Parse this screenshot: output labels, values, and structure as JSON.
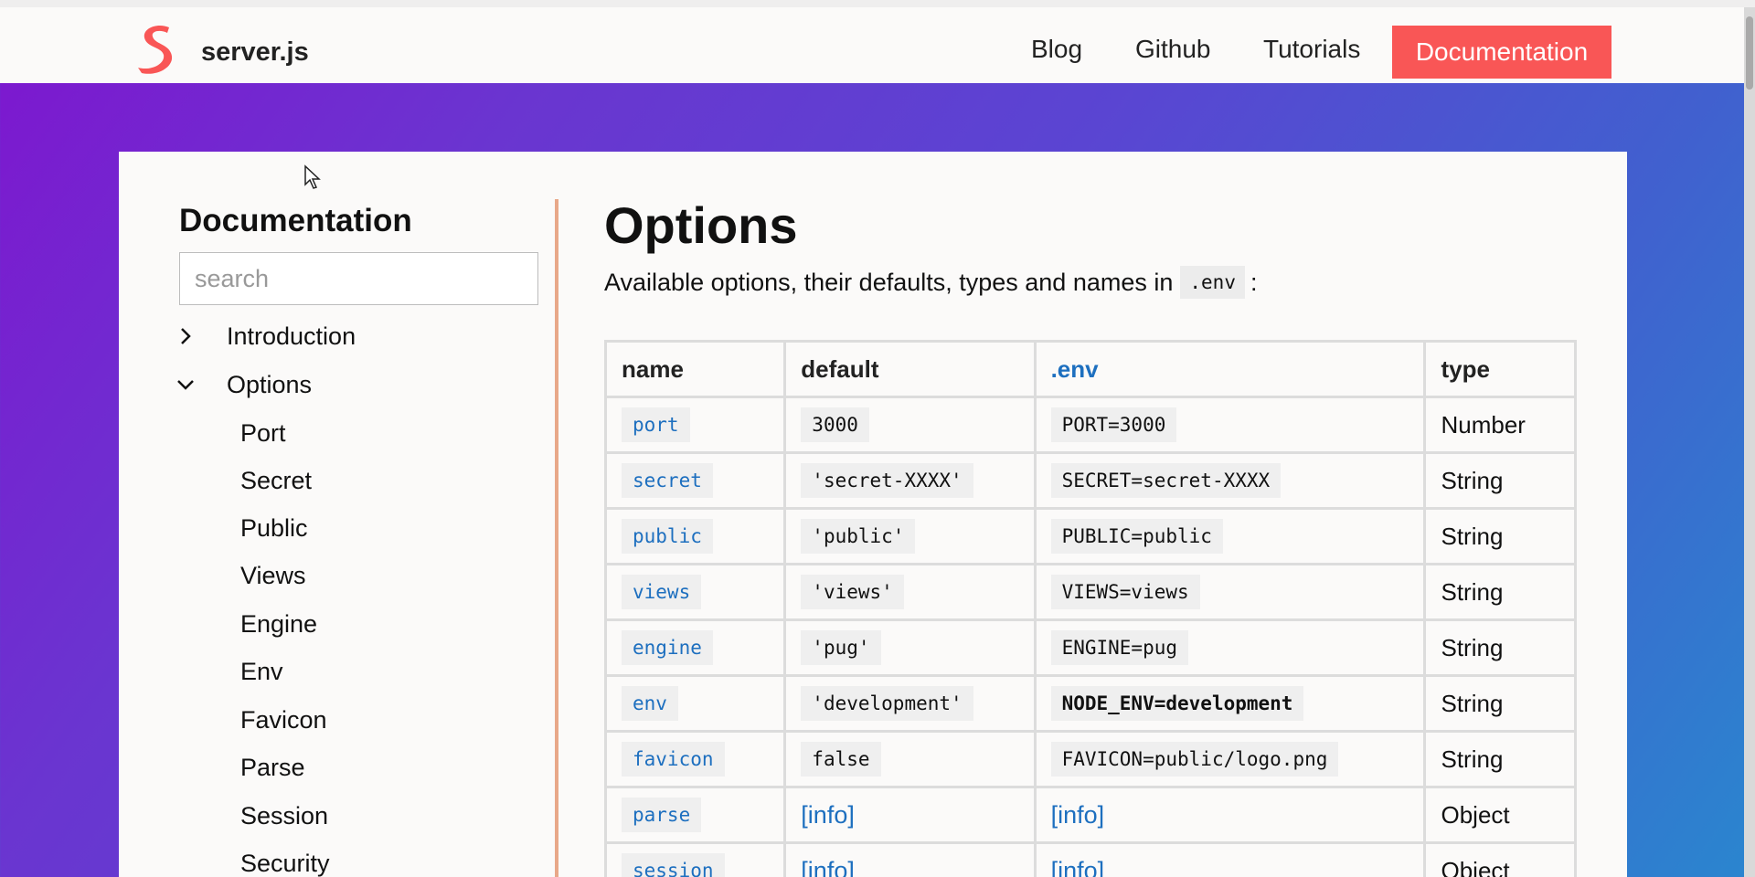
{
  "header": {
    "brand": "server.js",
    "nav": [
      "Blog",
      "Github",
      "Tutorials"
    ],
    "active": "Documentation",
    "colors": {
      "accent": "#f95656",
      "logo": "#f95656"
    }
  },
  "sidebar": {
    "title": "Documentation",
    "search_placeholder": "search",
    "sections": [
      {
        "label": "Introduction",
        "icon": "chevron-right-icon"
      },
      {
        "label": "Options",
        "icon": "chevron-down-icon"
      }
    ],
    "subitems": [
      "Port",
      "Secret",
      "Public",
      "Views",
      "Engine",
      "Env",
      "Favicon",
      "Parse",
      "Session",
      "Security"
    ]
  },
  "main": {
    "title": "Options",
    "intro_text": "Available options, their defaults, types and names in",
    "intro_code": ".env",
    "intro_suffix": ":",
    "table": {
      "headers": [
        "name",
        "default",
        ".env",
        "type"
      ],
      "rows": [
        [
          "port",
          "3000",
          "PORT=3000",
          "Number"
        ],
        [
          "secret",
          "'secret-XXXX'",
          "SECRET=secret-XXXX",
          "String"
        ],
        [
          "public",
          "'public'",
          "PUBLIC=public",
          "String"
        ],
        [
          "views",
          "'views'",
          "VIEWS=views",
          "String"
        ],
        [
          "engine",
          "'pug'",
          "ENGINE=pug",
          "String"
        ],
        [
          "env",
          "'development'",
          "NODE_ENV=development",
          "String"
        ],
        [
          "favicon",
          "false",
          "FAVICON=public/logo.png",
          "String"
        ],
        [
          "parse",
          "[info]",
          "[info]",
          "Object"
        ],
        [
          "session",
          "[info]",
          "[info]",
          "Object"
        ]
      ]
    }
  }
}
